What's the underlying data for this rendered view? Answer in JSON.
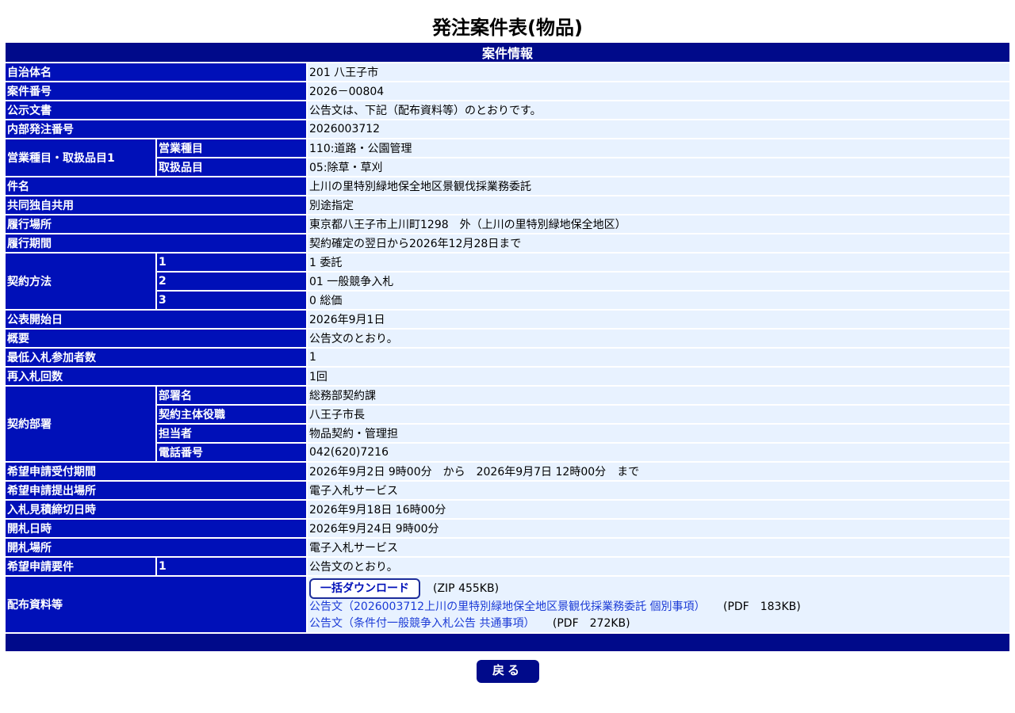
{
  "page_title": "発注案件表(物品)",
  "section_title": "案件情報",
  "rows": {
    "municipality": {
      "label": "自治体名",
      "value": "201 八王子市"
    },
    "case_number": {
      "label": "案件番号",
      "value": "2026－00804"
    },
    "public_notice": {
      "label": "公示文書",
      "value": "公告文は、下記（配布資料等）のとおりです。"
    },
    "internal_order_number": {
      "label": "内部発注番号",
      "value": "2026003712"
    },
    "business_category": {
      "label": "営業種目・取扱品目1",
      "business_type_label": "営業種目",
      "business_type_value": "110:道路・公園管理",
      "handling_item_label": "取扱品目",
      "handling_item_value": "05:除草・草刈"
    },
    "subject": {
      "label": "件名",
      "value": "上川の里特別緑地保全地区景観伐採業務委託"
    },
    "joint_use": {
      "label": "共同独自共用",
      "value": "別途指定"
    },
    "location": {
      "label": "履行場所",
      "value": "東京都八王子市上川町1298　外（上川の里特別緑地保全地区）"
    },
    "period": {
      "label": "履行期間",
      "value": "契約確定の翌日から2026年12月28日まで"
    },
    "contract_method": {
      "label": "契約方法",
      "items": [
        {
          "num": "1",
          "value": "1 委託"
        },
        {
          "num": "2",
          "value": "01 一般競争入札"
        },
        {
          "num": "3",
          "value": "0 総価"
        }
      ]
    },
    "publish_start": {
      "label": "公表開始日",
      "value": "2026年9月1日"
    },
    "summary": {
      "label": "概要",
      "value": "公告文のとおり。"
    },
    "min_bidders": {
      "label": "最低入札参加者数",
      "value": "1"
    },
    "rebid_count": {
      "label": "再入札回数",
      "value": "1回"
    },
    "contract_dept": {
      "label": "契約部署",
      "dept_name_label": "部署名",
      "dept_name_value": "総務部契約課",
      "contract_principal_label": "契約主体役職",
      "contract_principal_value": "八王子市長",
      "person_label": "担当者",
      "person_value": "物品契約・管理担",
      "phone_label": "電話番号",
      "phone_value": "042(620)7216"
    },
    "application_period": {
      "label": "希望申請受付期間",
      "value": "2026年9月2日 9時00分　から　2026年9月7日 12時00分　まで"
    },
    "application_place": {
      "label": "希望申請提出場所",
      "value": "電子入札サービス"
    },
    "bid_deadline": {
      "label": "入札見積締切日時",
      "value": "2026年9月18日 16時00分"
    },
    "opening_datetime": {
      "label": "開札日時",
      "value": "2026年9月24日 9時00分"
    },
    "opening_place": {
      "label": "開札場所",
      "value": "電子入札サービス"
    },
    "application_requirements": {
      "label": "希望申請要件",
      "num": "1",
      "value": "公告文のとおり。"
    },
    "distribution": {
      "label": "配布資料等",
      "bulk_download_label": "一括ダウンロード",
      "bulk_download_size": "(ZIP 455KB)",
      "doc1_link": "公告文（2026003712上川の里特別緑地保全地区景観伐採業務委託 個別事項）",
      "doc1_size": "(PDF　183KB)",
      "doc2_link": "公告文（条件付一般競争入札公告 共通事項）",
      "doc2_size": "(PDF　272KB)"
    }
  },
  "back_button_label": "戻る",
  "colors": {
    "header_bg": "#000a8a",
    "label_bg": "#0010b8",
    "value_bg": "#e8f2ff",
    "link": "#1b3bd6"
  }
}
